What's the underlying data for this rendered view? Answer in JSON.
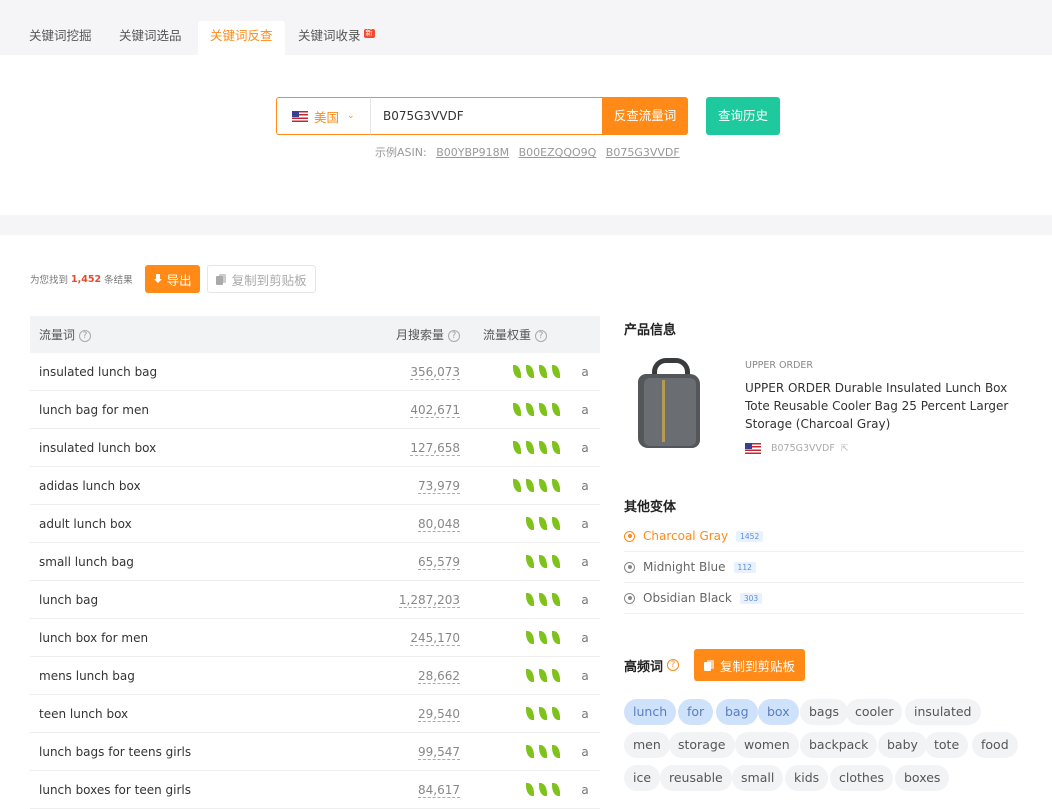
{
  "tabs": [
    {
      "label": "关键词挖掘",
      "active": false
    },
    {
      "label": "关键词选品",
      "active": false
    },
    {
      "label": "关键词反查",
      "active": true
    },
    {
      "label": "关键词收录",
      "active": false,
      "badge": "新"
    }
  ],
  "search": {
    "country": "美国",
    "asin_value": "B075G3VVDF",
    "reverse_button": "反查流量词",
    "history_button": "查询历史",
    "examples_label": "示例ASIN:",
    "examples": [
      "B00YBP918M",
      "B00EZQQO9Q",
      "B075G3VVDF"
    ]
  },
  "results": {
    "prefix": "为您找到",
    "count": "1,452",
    "suffix": "条结果",
    "export_label": "导出",
    "copy_label": "复制到剪贴板"
  },
  "table": {
    "headers": {
      "keyword": "流量词",
      "volume": "月搜索量",
      "weight": "流量权重"
    },
    "rows": [
      {
        "keyword": "insulated lunch bag",
        "volume": "356,073",
        "weight": 4,
        "amz": "a"
      },
      {
        "keyword": "lunch bag for men",
        "volume": "402,671",
        "weight": 4,
        "amz": "a"
      },
      {
        "keyword": "insulated lunch box",
        "volume": "127,658",
        "weight": 4,
        "amz": "a"
      },
      {
        "keyword": "adidas lunch box",
        "volume": "73,979",
        "weight": 4,
        "amz": "a"
      },
      {
        "keyword": "adult lunch box",
        "volume": "80,048",
        "weight": 3,
        "amz": "a"
      },
      {
        "keyword": "small lunch bag",
        "volume": "65,579",
        "weight": 3,
        "amz": "a"
      },
      {
        "keyword": "lunch bag",
        "volume": "1,287,203",
        "weight": 3,
        "amz": "a"
      },
      {
        "keyword": "lunch box for men",
        "volume": "245,170",
        "weight": 3,
        "amz": "a"
      },
      {
        "keyword": "mens lunch bag",
        "volume": "28,662",
        "weight": 3,
        "amz": "a"
      },
      {
        "keyword": "teen lunch box",
        "volume": "29,540",
        "weight": 3,
        "amz": "a"
      },
      {
        "keyword": "lunch bags for teens girls",
        "volume": "99,547",
        "weight": 3,
        "amz": "a"
      },
      {
        "keyword": "lunch boxes for teen girls",
        "volume": "84,617",
        "weight": 3,
        "amz": "a"
      }
    ]
  },
  "product": {
    "section_title": "产品信息",
    "brand": "UPPER ORDER",
    "title": "UPPER ORDER Durable Insulated Lunch Box Tote Reusable Cooler Bag 25 Percent Larger Storage (Charcoal Gray)",
    "asin": "B075G3VVDF"
  },
  "variants": {
    "section_title": "其他变体",
    "items": [
      {
        "name": "Charcoal Gray",
        "count": "1452",
        "active": true
      },
      {
        "name": "Midnight Blue",
        "count": "112",
        "active": false
      },
      {
        "name": "Obsidian Black",
        "count": "303",
        "active": false
      }
    ]
  },
  "high_freq": {
    "section_title": "高频词",
    "copy_label": "复制到剪贴板",
    "tags": [
      {
        "text": "lunch",
        "hl": true
      },
      {
        "text": "for",
        "hl": true
      },
      {
        "text": "bag",
        "hl": true
      },
      {
        "text": "box",
        "hl": true
      },
      {
        "text": "bags",
        "hl": false
      },
      {
        "text": "cooler",
        "hl": false
      },
      {
        "text": "insulated",
        "hl": false
      },
      {
        "text": "men",
        "hl": false
      },
      {
        "text": "storage",
        "hl": false
      },
      {
        "text": "women",
        "hl": false
      },
      {
        "text": "backpack",
        "hl": false
      },
      {
        "text": "baby",
        "hl": false
      },
      {
        "text": "tote",
        "hl": false
      },
      {
        "text": "food",
        "hl": false
      },
      {
        "text": "ice",
        "hl": false
      },
      {
        "text": "reusable",
        "hl": false
      },
      {
        "text": "small",
        "hl": false
      },
      {
        "text": "kids",
        "hl": false
      },
      {
        "text": "clothes",
        "hl": false
      },
      {
        "text": "boxes",
        "hl": false
      }
    ]
  },
  "colors": {
    "accent": "#ff8a17",
    "teal": "#1ec99e",
    "leaf": "#7ec21b",
    "count": "#e54b2b",
    "tag_highlight": "#cfe2fb"
  }
}
